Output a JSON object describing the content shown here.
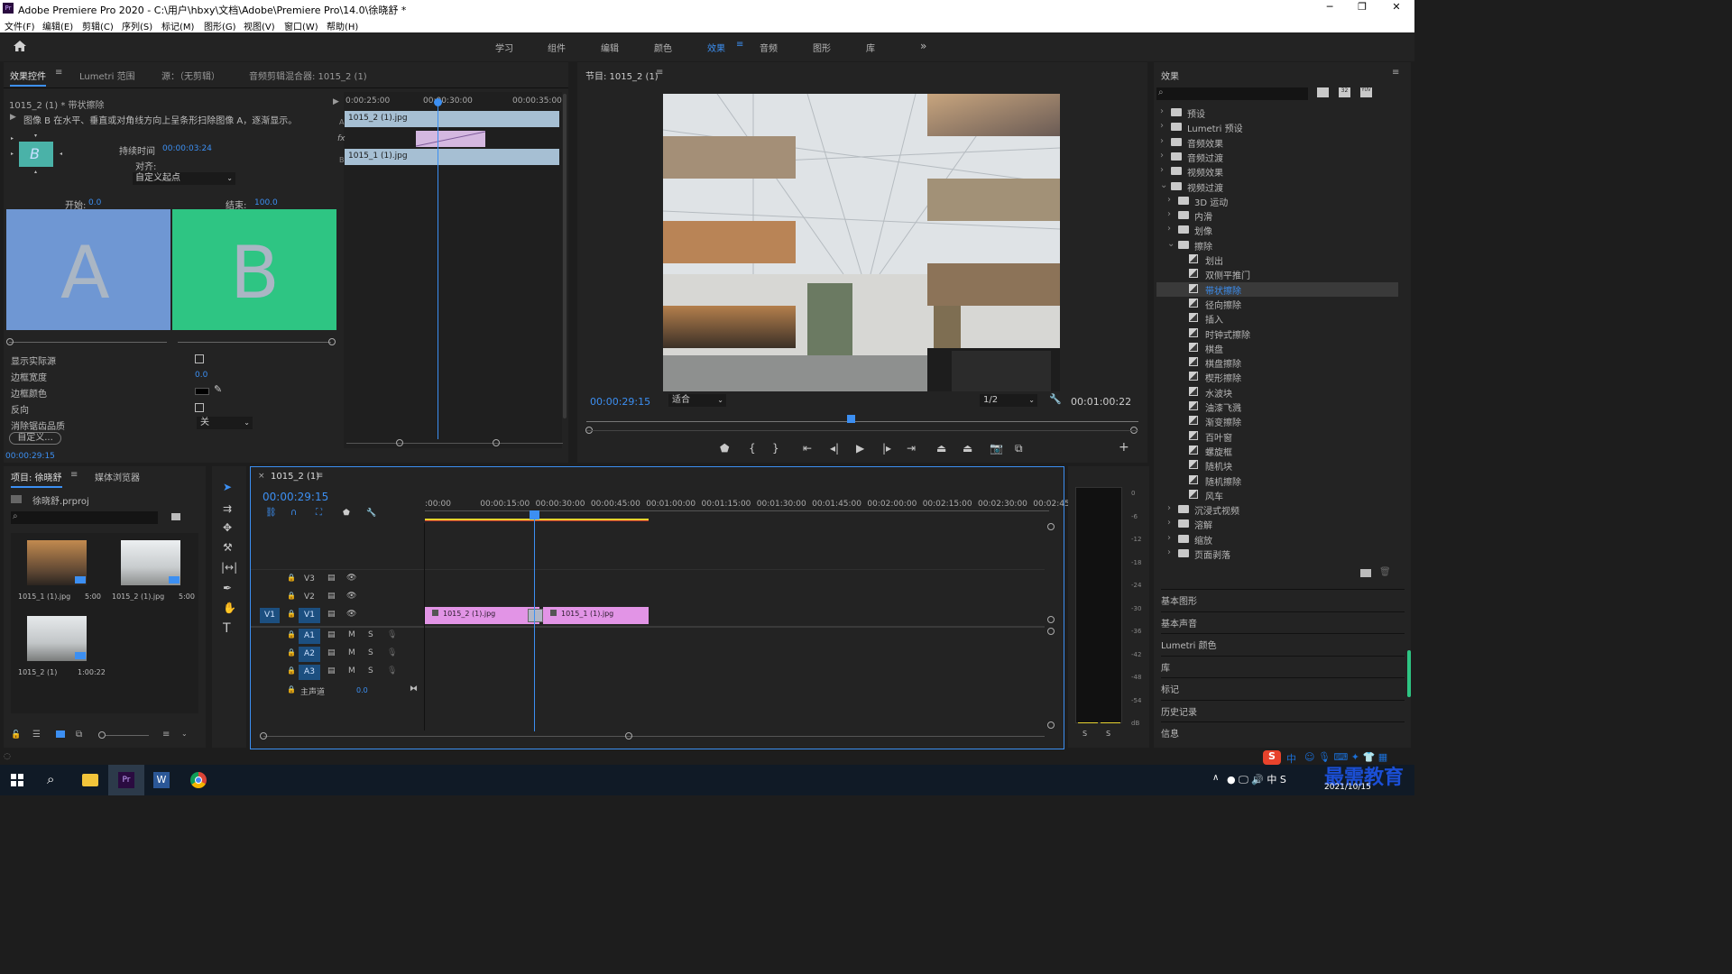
{
  "window": {
    "title": "Adobe Premiere Pro 2020 - C:\\用户\\hbxy\\文档\\Adobe\\Premiere Pro\\14.0\\徐晓舒 *",
    "app_icon": "Pr"
  },
  "menu": [
    "文件(F)",
    "编辑(E)",
    "剪辑(C)",
    "序列(S)",
    "标记(M)",
    "图形(G)",
    "视图(V)",
    "窗口(W)",
    "帮助(H)"
  ],
  "workspaces": [
    "学习",
    "组件",
    "编辑",
    "颜色",
    "效果",
    "音频",
    "图形",
    "库"
  ],
  "active_workspace": "效果",
  "accent": "#3c8ff2",
  "effect_controls": {
    "tabs": [
      "效果控件",
      "Lumetri 范围",
      "源：（无剪辑）",
      "音频剪辑混合器: 1015_2 (1)"
    ],
    "clip_label": "1015_2 (1) * 带状擦除",
    "description": "图像 B 在水平、垂直或对角线方向上呈条形扫除图像 A，逐渐显示。",
    "duration_label": "持续时间",
    "duration": "00:00:03:24",
    "align_label": "对齐:",
    "align_value": "自定义起点",
    "start_label": "开始:",
    "start_value": "0.0",
    "end_label": "结束:",
    "end_value": "100.0",
    "preview_a": "A",
    "preview_b": "B",
    "show_actual_source": "显示实际源",
    "border_width_label": "边框宽度",
    "border_width": "0.0",
    "border_color_label": "边框颜色",
    "reverse_label": "反向",
    "antialias_label": "消除锯齿品质",
    "antialias_value": "关",
    "custom_button": "自定义...",
    "timecode": "00:00:29:15",
    "mini_ruler": [
      "0:00:25:00",
      "00:00:30:00",
      "00:00:35:00"
    ],
    "clip_a": "1015_2 (1).jpg",
    "clip_b": "1015_1 (1).jpg",
    "track_a": "A",
    "track_b": "B",
    "fx_label": "fx"
  },
  "program": {
    "title": "节目: 1015_2 (1)",
    "timecode": "00:00:29:15",
    "fit": "适合",
    "res": "1/2",
    "duration": "00:01:00:22"
  },
  "effects": {
    "title": "效果",
    "items": [
      {
        "label": "预设",
        "type": "folder",
        "depth": 0,
        "open": false
      },
      {
        "label": "Lumetri 预设",
        "type": "folder",
        "depth": 0,
        "open": false
      },
      {
        "label": "音频效果",
        "type": "folder",
        "depth": 0,
        "open": false
      },
      {
        "label": "音频过渡",
        "type": "folder",
        "depth": 0,
        "open": false
      },
      {
        "label": "视频效果",
        "type": "folder",
        "depth": 0,
        "open": false
      },
      {
        "label": "视频过渡",
        "type": "folder",
        "depth": 0,
        "open": true
      },
      {
        "label": "3D 运动",
        "type": "folder",
        "depth": 1,
        "open": false
      },
      {
        "label": "内滑",
        "type": "folder",
        "depth": 1,
        "open": false
      },
      {
        "label": "划像",
        "type": "folder",
        "depth": 1,
        "open": false
      },
      {
        "label": "擦除",
        "type": "folder",
        "depth": 1,
        "open": true
      },
      {
        "label": "划出",
        "type": "fx",
        "depth": 2
      },
      {
        "label": "双侧平推门",
        "type": "fx",
        "depth": 2
      },
      {
        "label": "带状擦除",
        "type": "fx",
        "depth": 2,
        "selected": true
      },
      {
        "label": "径向擦除",
        "type": "fx",
        "depth": 2
      },
      {
        "label": "插入",
        "type": "fx",
        "depth": 2
      },
      {
        "label": "时钟式擦除",
        "type": "fx",
        "depth": 2
      },
      {
        "label": "棋盘",
        "type": "fx",
        "depth": 2
      },
      {
        "label": "棋盘擦除",
        "type": "fx",
        "depth": 2
      },
      {
        "label": "楔形擦除",
        "type": "fx",
        "depth": 2
      },
      {
        "label": "水波块",
        "type": "fx",
        "depth": 2
      },
      {
        "label": "油漆飞溅",
        "type": "fx",
        "depth": 2
      },
      {
        "label": "渐变擦除",
        "type": "fx",
        "depth": 2
      },
      {
        "label": "百叶窗",
        "type": "fx",
        "depth": 2
      },
      {
        "label": "螺旋框",
        "type": "fx",
        "depth": 2
      },
      {
        "label": "随机块",
        "type": "fx",
        "depth": 2
      },
      {
        "label": "随机擦除",
        "type": "fx",
        "depth": 2
      },
      {
        "label": "风车",
        "type": "fx",
        "depth": 2
      },
      {
        "label": "沉浸式视频",
        "type": "folder",
        "depth": 1,
        "open": false
      },
      {
        "label": "溶解",
        "type": "folder",
        "depth": 1,
        "open": false
      },
      {
        "label": "缩放",
        "type": "folder",
        "depth": 1,
        "open": false
      },
      {
        "label": "页面剥落",
        "type": "folder",
        "depth": 1,
        "open": false
      }
    ],
    "sections": [
      "基本图形",
      "基本声音",
      "Lumetri 颜色",
      "库",
      "标记",
      "历史记录",
      "信息"
    ]
  },
  "project": {
    "tabs": [
      "项目: 徐晓舒",
      "媒体浏览器"
    ],
    "file": "徐晓舒.prproj",
    "items": [
      {
        "name": "1015_1 (1).jpg",
        "duration": "5:00"
      },
      {
        "name": "1015_2 (1).jpg",
        "duration": "5:00"
      },
      {
        "name": "1015_2 (1)",
        "duration": "1:00:22"
      }
    ]
  },
  "timeline": {
    "tab": "1015_2 (1)",
    "timecode": "00:00:29:15",
    "ruler": [
      ":00:00",
      "00:00:15:00",
      "00:00:30:00",
      "00:00:45:00",
      "00:01:00:00",
      "00:01:15:00",
      "00:01:30:00",
      "00:01:45:00",
      "00:02:00:00",
      "00:02:15:00",
      "00:02:30:00",
      "00:02:45:"
    ],
    "video_tracks": [
      "V3",
      "V2",
      "V1"
    ],
    "audio_tracks": [
      "A1",
      "A2",
      "A3"
    ],
    "source_patch": "V1",
    "master_label": "主声道",
    "master_value": "0.0",
    "clips": [
      "1015_2 (1).jpg",
      "1015_1 (1).jpg"
    ],
    "m": "M",
    "s": "S"
  },
  "meter": {
    "scale": [
      "0",
      "-6",
      "-12",
      "-18",
      "-24",
      "-30",
      "-36",
      "-42",
      "-48",
      "-54",
      "dB"
    ],
    "solo": [
      "S",
      "S"
    ]
  },
  "taskbar": {
    "date": "2021/10/15",
    "watermark": "最需教育",
    "ime": "中"
  }
}
